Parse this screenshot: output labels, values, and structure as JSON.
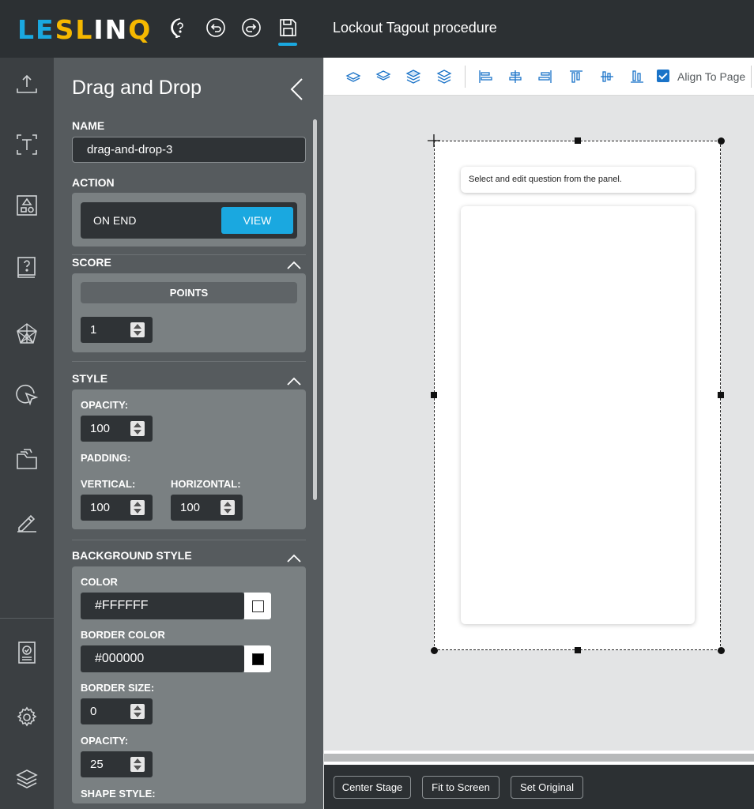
{
  "app": {
    "logo": "LESLINQ",
    "document_title": "Lockout Tagout procedure"
  },
  "topbar_icons": [
    "help-icon",
    "undo-icon",
    "redo-icon",
    "save-icon"
  ],
  "rail_icons": [
    "upload-icon",
    "text-icon",
    "shapes-icon",
    "question-icon",
    "network-icon",
    "cursor-icon",
    "folder-icon",
    "edit-icon",
    "assessment-icon",
    "settings-icon",
    "layers-icon"
  ],
  "panel": {
    "title": "Drag and Drop",
    "name_label": "NAME",
    "name_value": "drag-and-drop-3",
    "action_label": "ACTION",
    "action_event": "ON END",
    "action_button": "VIEW",
    "score_label": "SCORE",
    "points_label": "POINTS",
    "points_value": "1",
    "style_label": "STYLE",
    "opacity_label": "OPACITY:",
    "opacity_value": "100",
    "padding_label": "PADDING:",
    "vertical_label": "VERTICAL:",
    "vertical_value": "100",
    "horizontal_label": "HORIZONTAL:",
    "horizontal_value": "100",
    "bg_style_label": "BACKGROUND STYLE",
    "color_label": "COLOR",
    "color_value": "#FFFFFF",
    "border_color_label": "BORDER COLOR",
    "border_color_value": "#000000",
    "border_size_label": "BORDER SIZE:",
    "border_size_value": "0",
    "bg_opacity_label": "OPACITY:",
    "bg_opacity_value": "25",
    "shape_style_label": "SHAPE STYLE:"
  },
  "toolbar": {
    "align_to_page_label": "Align To Page",
    "align_to_page_checked": true
  },
  "stage": {
    "question_text": "Select and edit question from the panel."
  },
  "bottom": {
    "center_stage": "Center Stage",
    "fit_to_screen": "Fit to Screen",
    "set_original": "Set Original"
  },
  "colors": {
    "accent": "#1aa8e0",
    "topbar": "#2c3033",
    "panel": "#565b5e",
    "card": "#7a8082"
  }
}
